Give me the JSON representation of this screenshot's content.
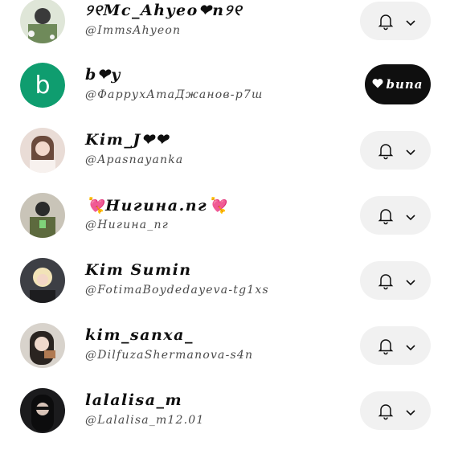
{
  "channels": [
    {
      "name": "୨୧Mc_Ahyeo❤n୨୧",
      "handle": "@ImmsAhyeon",
      "button": "bell"
    },
    {
      "avatar_letter": "b",
      "avatar_color": "#0f9d6f",
      "name": "b❤y",
      "handle": "@ФаррухАтаДжанов-р7ш",
      "button": "join",
      "join_label": "buna",
      "join_icon": "heart-icon"
    },
    {
      "name": "Kim_J❤❤",
      "handle": "@Apasnayanka",
      "button": "bell"
    },
    {
      "name": "💘Нигина.пг💘",
      "handle": "@Нигина_пг",
      "button": "bell"
    },
    {
      "name": "Kim Sumin",
      "handle": "@FotimaBoydedayeva-tg1xs",
      "button": "bell"
    },
    {
      "name": "kim_sanxa_",
      "handle": "@DilfuzaShermanova-s4n",
      "button": "bell"
    },
    {
      "name": "lalalisa_m",
      "handle": "@Lalalisa_m12.01",
      "button": "bell"
    }
  ],
  "icons": {
    "bell": "bell-icon",
    "chevron": "chevron-down-icon"
  },
  "colors": {
    "pill_bg": "#f1f1f1",
    "join_bg": "#0f0f0f",
    "text": "#0f0f0f",
    "handle": "#4a4a4a"
  }
}
